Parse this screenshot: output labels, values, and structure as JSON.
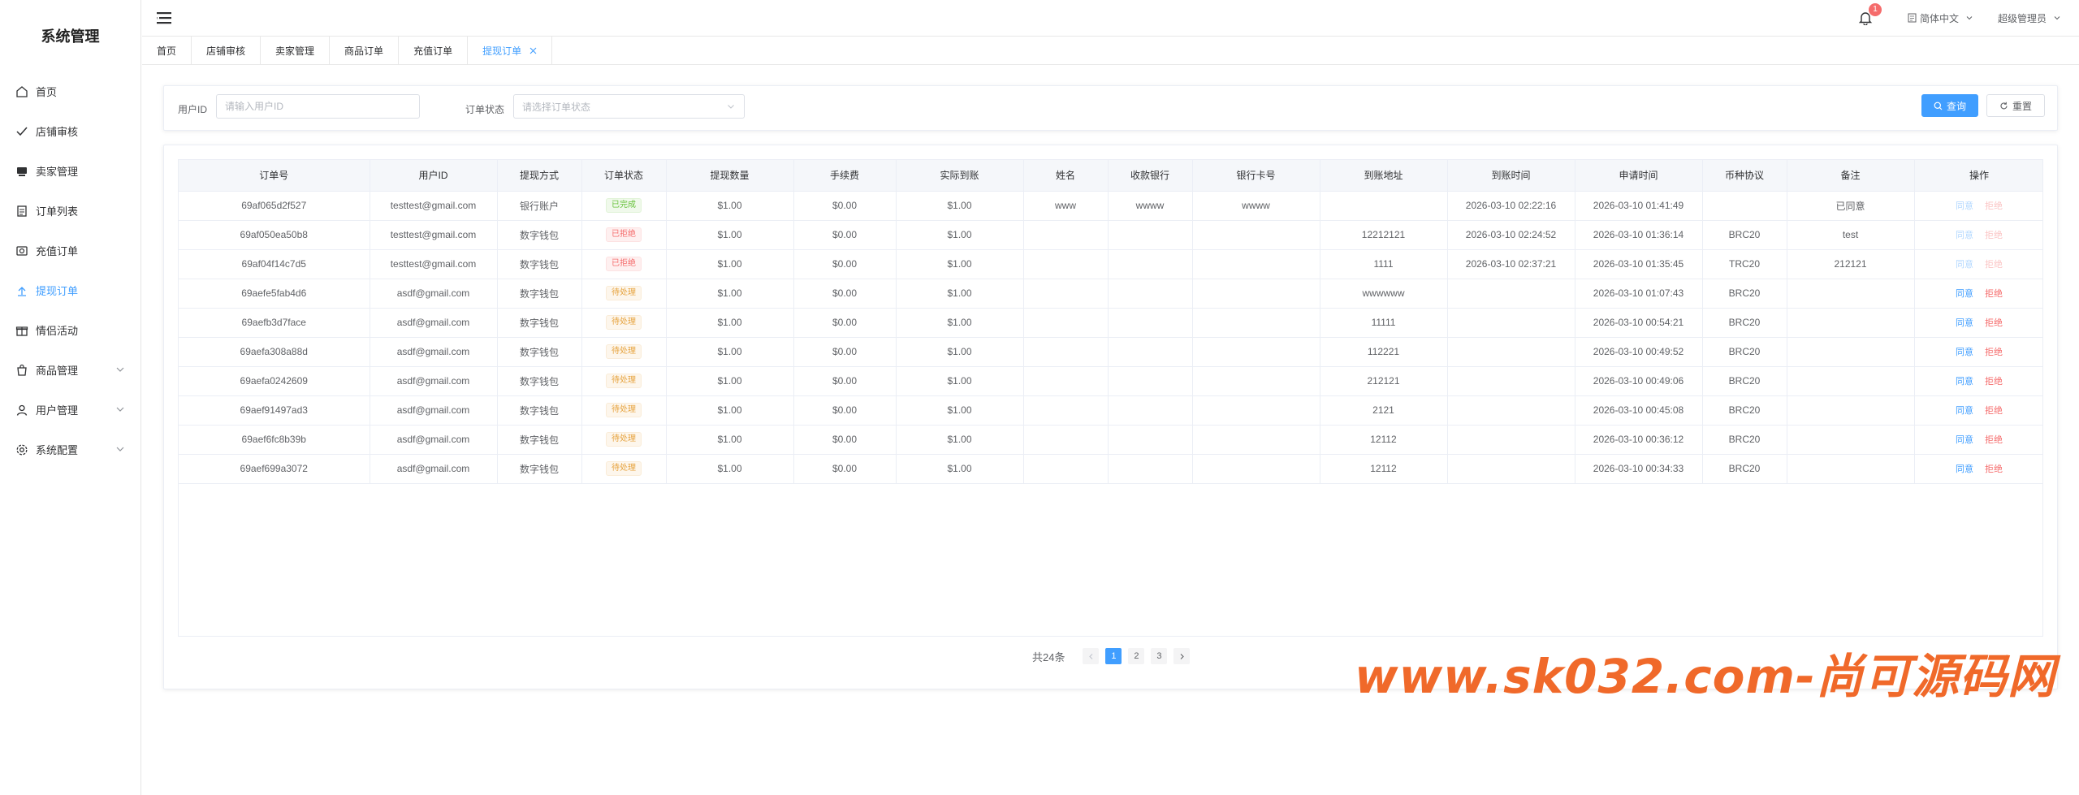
{
  "sidebar": {
    "title": "系统管理",
    "items": [
      {
        "label": "首页",
        "icon": "home-icon"
      },
      {
        "label": "店铺审核",
        "icon": "check-icon"
      },
      {
        "label": "卖家管理",
        "icon": "seller-icon"
      },
      {
        "label": "订单列表",
        "icon": "document-icon"
      },
      {
        "label": "充值订单",
        "icon": "recharge-icon"
      },
      {
        "label": "提现订单",
        "icon": "upload-icon"
      },
      {
        "label": "情侣活动",
        "icon": "gift-icon"
      },
      {
        "label": "商品管理",
        "icon": "bag-icon"
      },
      {
        "label": "用户管理",
        "icon": "user-icon"
      },
      {
        "label": "系统配置",
        "icon": "gear-icon"
      }
    ]
  },
  "header": {
    "notification_count": "1",
    "language": "简体中文",
    "user": "超级管理员"
  },
  "tabs": [
    {
      "label": "首页"
    },
    {
      "label": "店铺审核"
    },
    {
      "label": "卖家管理"
    },
    {
      "label": "商品订单"
    },
    {
      "label": "充值订单"
    },
    {
      "label": "提现订单"
    }
  ],
  "search": {
    "user_id_label": "用户ID",
    "user_id_placeholder": "请输入用户ID",
    "status_label": "订单状态",
    "status_placeholder": "请选择订单状态",
    "query_button": "查询",
    "reset_button": "重置"
  },
  "table": {
    "columns": [
      "订单号",
      "用户ID",
      "提现方式",
      "订单状态",
      "提现数量",
      "手续费",
      "实际到账",
      "姓名",
      "收款银行",
      "银行卡号",
      "到账地址",
      "到账时间",
      "申请时间",
      "币种协议",
      "备注",
      "操作"
    ],
    "rows": [
      {
        "order": "69af065d2f527",
        "user": "testtest@gmail.com",
        "method": "银行账户",
        "status": "已完成",
        "status_type": "success",
        "amount": "$1.00",
        "fee": "$0.00",
        "actual": "$1.00",
        "name": "www",
        "bank": "wwww",
        "card": "wwww",
        "address": "",
        "arrive_time": "2026-03-10 02:22:16",
        "apply_time": "2026-03-10 01:41:49",
        "protocol": "",
        "remark": "已同意",
        "ops_disabled": true
      },
      {
        "order": "69af050ea50b8",
        "user": "testtest@gmail.com",
        "method": "数字钱包",
        "status": "已拒绝",
        "status_type": "danger",
        "amount": "$1.00",
        "fee": "$0.00",
        "actual": "$1.00",
        "name": "",
        "bank": "",
        "card": "",
        "address": "12212121",
        "arrive_time": "2026-03-10 02:24:52",
        "apply_time": "2026-03-10 01:36:14",
        "protocol": "BRC20",
        "remark": "test",
        "ops_disabled": true
      },
      {
        "order": "69af04f14c7d5",
        "user": "testtest@gmail.com",
        "method": "数字钱包",
        "status": "已拒绝",
        "status_type": "danger",
        "amount": "$1.00",
        "fee": "$0.00",
        "actual": "$1.00",
        "name": "",
        "bank": "",
        "card": "",
        "address": "1111",
        "arrive_time": "2026-03-10 02:37:21",
        "apply_time": "2026-03-10 01:35:45",
        "protocol": "TRC20",
        "remark": "212121",
        "ops_disabled": true
      },
      {
        "order": "69aefe5fab4d6",
        "user": "asdf@gmail.com",
        "method": "数字钱包",
        "status": "待处理",
        "status_type": "warning",
        "amount": "$1.00",
        "fee": "$0.00",
        "actual": "$1.00",
        "name": "",
        "bank": "",
        "card": "",
        "address": "wwwwww",
        "arrive_time": "",
        "apply_time": "2026-03-10 01:07:43",
        "protocol": "BRC20",
        "remark": "",
        "ops_disabled": false
      },
      {
        "order": "69aefb3d7face",
        "user": "asdf@gmail.com",
        "method": "数字钱包",
        "status": "待处理",
        "status_type": "warning",
        "amount": "$1.00",
        "fee": "$0.00",
        "actual": "$1.00",
        "name": "",
        "bank": "",
        "card": "",
        "address": "11111",
        "arrive_time": "",
        "apply_time": "2026-03-10 00:54:21",
        "protocol": "BRC20",
        "remark": "",
        "ops_disabled": false
      },
      {
        "order": "69aefa308a88d",
        "user": "asdf@gmail.com",
        "method": "数字钱包",
        "status": "待处理",
        "status_type": "warning",
        "amount": "$1.00",
        "fee": "$0.00",
        "actual": "$1.00",
        "name": "",
        "bank": "",
        "card": "",
        "address": "112221",
        "arrive_time": "",
        "apply_time": "2026-03-10 00:49:52",
        "protocol": "BRC20",
        "remark": "",
        "ops_disabled": false
      },
      {
        "order": "69aefa0242609",
        "user": "asdf@gmail.com",
        "method": "数字钱包",
        "status": "待处理",
        "status_type": "warning",
        "amount": "$1.00",
        "fee": "$0.00",
        "actual": "$1.00",
        "name": "",
        "bank": "",
        "card": "",
        "address": "212121",
        "arrive_time": "",
        "apply_time": "2026-03-10 00:49:06",
        "protocol": "BRC20",
        "remark": "",
        "ops_disabled": false
      },
      {
        "order": "69aef91497ad3",
        "user": "asdf@gmail.com",
        "method": "数字钱包",
        "status": "待处理",
        "status_type": "warning",
        "amount": "$1.00",
        "fee": "$0.00",
        "actual": "$1.00",
        "name": "",
        "bank": "",
        "card": "",
        "address": "2121",
        "arrive_time": "",
        "apply_time": "2026-03-10 00:45:08",
        "protocol": "BRC20",
        "remark": "",
        "ops_disabled": false
      },
      {
        "order": "69aef6fc8b39b",
        "user": "asdf@gmail.com",
        "method": "数字钱包",
        "status": "待处理",
        "status_type": "warning",
        "amount": "$1.00",
        "fee": "$0.00",
        "actual": "$1.00",
        "name": "",
        "bank": "",
        "card": "",
        "address": "12112",
        "arrive_time": "",
        "apply_time": "2026-03-10 00:36:12",
        "protocol": "BRC20",
        "remark": "",
        "ops_disabled": false
      },
      {
        "order": "69aef699a3072",
        "user": "asdf@gmail.com",
        "method": "数字钱包",
        "status": "待处理",
        "status_type": "warning",
        "amount": "$1.00",
        "fee": "$0.00",
        "actual": "$1.00",
        "name": "",
        "bank": "",
        "card": "",
        "address": "12112",
        "arrive_time": "",
        "apply_time": "2026-03-10 00:34:33",
        "protocol": "BRC20",
        "remark": "",
        "ops_disabled": false
      }
    ],
    "op_agree": "同意",
    "op_reject": "拒绝"
  },
  "pagination": {
    "total": "共24条",
    "pages": [
      "1",
      "2",
      "3"
    ],
    "current": "1",
    "prev_icon": "chevron-left-icon",
    "next_icon": "chevron-right-icon"
  },
  "watermark": "www.sk032.com-尚可源码网",
  "colors": {
    "accent": "#409eff",
    "success": "#67c23a",
    "danger": "#f56c6c",
    "warning": "#e6a23c",
    "watermark": "#f0692a"
  }
}
